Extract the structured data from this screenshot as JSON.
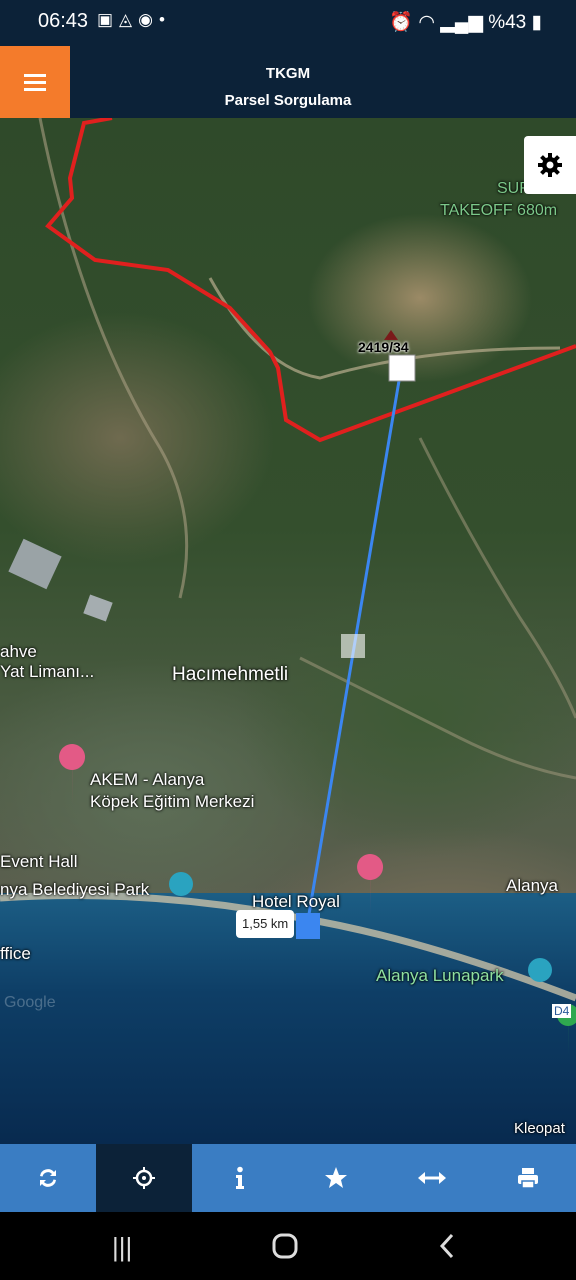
{
  "status_bar": {
    "time": "06:43",
    "battery": "%43"
  },
  "header": {
    "title": "TKGM",
    "subtitle": "Parsel Sorgulama"
  },
  "map": {
    "parcel_label": "2419/34",
    "distance_label": "1,55 km",
    "place_labels": {
      "surf": "SUR",
      "takeoff": "TAKEOFF 680m",
      "kahve": "ahve",
      "yat_limani": "Yat Limanı...",
      "hacimehmetli": "Hacımehmetli",
      "akem_line1": "AKEM - Alanya",
      "akem_line2": "Köpek Eğitim Merkezi",
      "event_hall": "Event Hall",
      "belediyesi_park": "nya Belediyesi Park",
      "hotel_royal": "Hotel Royal",
      "alanya_a": "Alanya",
      "alanya_lunapark": "Alanya Lunapark",
      "office": "ffice",
      "road_d4": "D4",
      "kleopat": "Kleopat",
      "google": "Google"
    }
  },
  "colors": {
    "header_bg": "#0c2238",
    "menu_button": "#f47b2b",
    "toolbar_bg": "#3a7dc3",
    "toolbar_active": "#0c2238",
    "boundary_line": "#e0201e",
    "measure_line": "#3b86f0"
  },
  "toolbar": [
    {
      "name": "refresh",
      "icon": "refresh-icon"
    },
    {
      "name": "locate",
      "icon": "crosshair-icon",
      "active": true
    },
    {
      "name": "info",
      "icon": "info-icon"
    },
    {
      "name": "favorite",
      "icon": "star-icon"
    },
    {
      "name": "measure",
      "icon": "arrows-horizontal-icon"
    },
    {
      "name": "print",
      "icon": "printer-icon"
    }
  ]
}
